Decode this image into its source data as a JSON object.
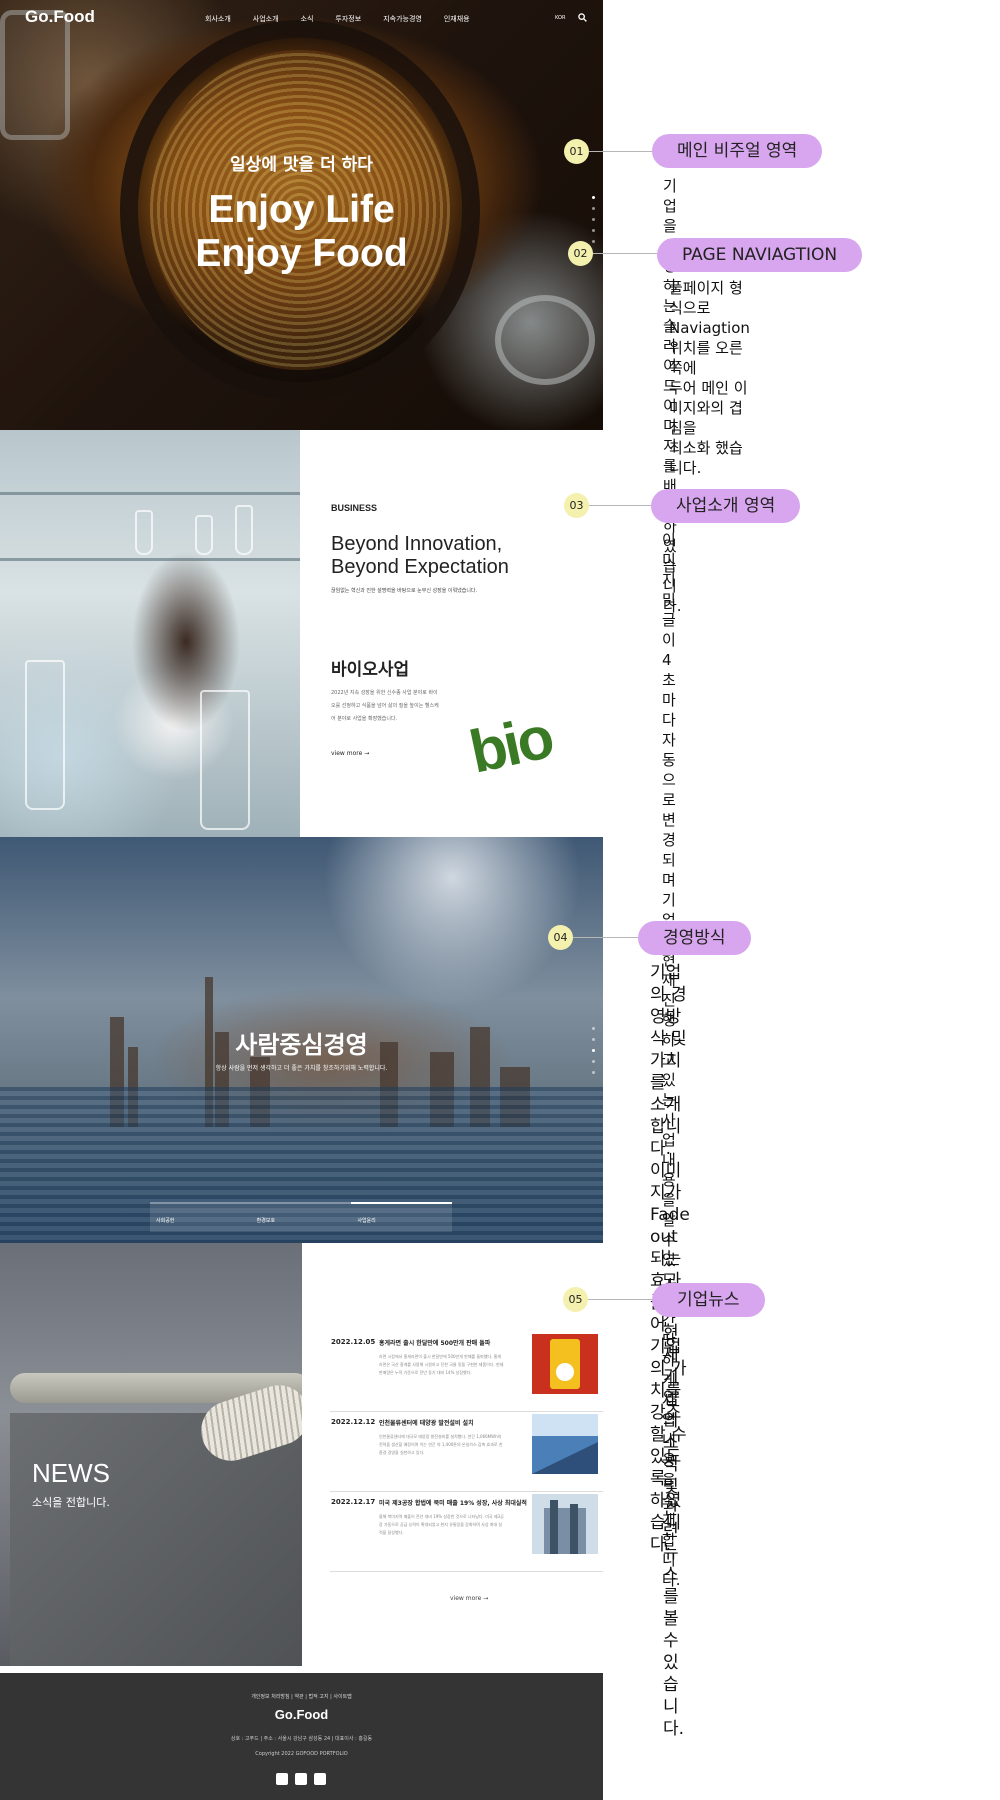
{
  "hero": {
    "logo": "Go.Food",
    "nav": [
      "회사소개",
      "사업소개",
      "소식",
      "투자정보",
      "지속가능경영",
      "인재채용"
    ],
    "lang": "KOR",
    "subtitle": "일상에 맛을 더 하다",
    "headline_1": "Enjoy Life",
    "headline_2": "Enjoy Food"
  },
  "business": {
    "label": "BUSINESS",
    "title_1": "Beyond Innovation,",
    "title_2": "Beyond Expectation",
    "desc": "끊임없는 혁신과 진한 설명력을 바탕으로 눈부신 성장을 이뤄냈습니다.",
    "bio_title": "바이오사업",
    "bio_desc": "2022년 지속 성장을 위한 신수종 사업 분야로 바이오를 선정하고 식품을 넘어 삶의 질을 높이는 헬스케어 분야로 사업을 확장했습니다.",
    "more": "view more",
    "bio_logo": "bio"
  },
  "management": {
    "heading": "사람중심경영",
    "sub": "항상 사람을 먼저 생각하고 더 좋은 가치를 창조하기위해 노력합니다.",
    "tabs": [
      "사회공헌",
      "환경보호",
      "사업윤리"
    ]
  },
  "news": {
    "title": "NEWS",
    "subtitle": "소식을 전합니다.",
    "items": [
      {
        "date": "2022.12.05",
        "headline": "홍게라면 출시 한달만에 500만개 판매 돌파",
        "body": "라면 시장에서 홍게라면이 출시 한달만에 500만개 판매를 돌파했다. 홍게라면은 국산 홍게를 사용해 시원하고 진한 국물 맛을 구현한 제품이다. 현재 판매량은 누적 기준으로 전년 동기 대비 14% 성장했다.",
        "thumb_color": "#c9301e"
      },
      {
        "date": "2022.12.12",
        "headline": "인천물류센터에 태양광 발전설비 설치",
        "body": "인천물류센터에 대규모 태양광 발전설비를 설치했다. 연간 1,066MWh의 전력을 생산할 예정이며 이는 연간 약 1,400톤의 온실가스 감축 효과로 친환경 경영을 실천하고 있다.",
        "thumb_color": "#4a7fb8"
      },
      {
        "date": "2022.12.17",
        "headline": "미국 제3공장 합법에 북미 매출 19% 성장, 사상 최대실적",
        "body": "올해 북미지역 매출이 전년 대비 19% 성장한 것으로 나타났다. 미국 제3공장 가동으로 공급 능력이 확대되었고 현지 유통망을 강화하며 사상 최대 실적을 달성했다.",
        "thumb_color": "#7a8fa6"
      }
    ],
    "more": "view more"
  },
  "footer": {
    "links": "개인정보 처리방침 | 약관 | 법적 고지 | 사이트맵",
    "logo": "Go.Food",
    "info": "상호 : 고푸드 | 주소 : 서울시 강남구 삼성동 24 | 대표이사 : 홍길동",
    "copy": "Copyright 2022 GOFOOD PORTFOLIO"
  },
  "annotations": [
    {
      "num": "01",
      "title": "메인 비주얼 영역",
      "note": "기업을 상징하는 슬라이드 이미지를\n 배치하였습니다."
    },
    {
      "num": "02",
      "title": "PAGE NAVIAGTION",
      "note": "풀페이지 형식으로\nNaviagtion 위치를 오른쪽에\n두어 메인 이미지와의 겹침을\n최소화 했습니다."
    },
    {
      "num": "03",
      "title": "사업소개 영역",
      "note": "이미지 및 글이 4초마다 자동으로\n변경되며 기업이 현재 진행하고 있는\n사업내용을 알 수 있도록\n간단하게 사업 내용을 소개합니다."
    },
    {
      "num": "04",
      "title": "경영방식",
      "note": "기업의 경영방식 및 가치를\n소개합니다.\n이미지가 Fade out 되는 효과를 주어\n기업의 가치를 강조할 수 있도록\n하였습니다."
    },
    {
      "num": "05",
      "title": "기업뉴스",
      "note": "현재 기업의 소식 및 관련 뉴스를\n볼 수 있습니다."
    }
  ]
}
